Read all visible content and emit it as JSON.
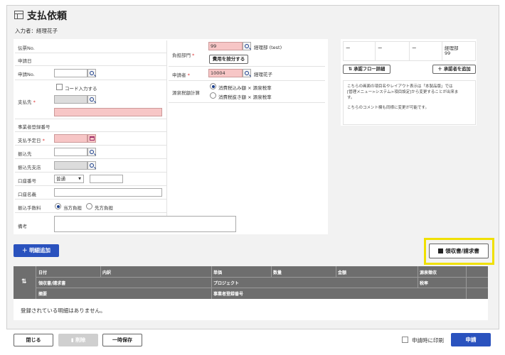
{
  "page": {
    "title": "支払依頼",
    "entrant": "入力者：経理花子"
  },
  "form": {
    "slip_no_label": "伝票No.",
    "apply_date_label": "申請日",
    "apply_no_label": "申請No.",
    "code_input_label": "コード入力する",
    "payee_label": "支払先",
    "required_mark": "*",
    "biz_reg_no_label": "事業者登録番号",
    "pay_due_label": "支払予定日",
    "bank_label": "振込先",
    "bank_branch_label": "振込先支店",
    "account_no_label": "口座番号",
    "account_type_value": "普通",
    "account_name_label": "口座名義",
    "fee_label": "振込手数料",
    "fee_options": [
      "当方負担",
      "先方負担"
    ],
    "notes_label": "備考",
    "dept_label": "負担部門",
    "dept_code": "99",
    "dept_name": "経理部 (test)",
    "split_cost_button": "費用を按分する",
    "applicant_label": "申請者",
    "applicant_code": "10004",
    "applicant_name": "経理花子",
    "wht_label": "源泉税額計算",
    "wht_options": [
      "消費税込み額 × 源泉税率",
      "消費税抜き額 × 源泉税率"
    ]
  },
  "approval": {
    "cells": [
      "ー",
      "ー",
      "ー"
    ],
    "final_cell": [
      "経理部",
      "99"
    ],
    "flow_button": "承認フロー詳細",
    "add_approver_button": "承認者を追加",
    "note_lines": [
      "こちらの画面の項目名やレイアウト表示は「本製品版」では",
      "[管理メニュー>システム>項目設定]から変更することが出来ま",
      "す。",
      "",
      "こちらのコメント欄も同様に変更が可能です。"
    ]
  },
  "details": {
    "add_button": "明細追加",
    "receipt_button": "領収書/請求書",
    "headers_row1": [
      "日付",
      "内訳",
      "単価",
      "数量",
      "金額",
      "源泉徴収"
    ],
    "headers_row2": [
      "領収書/請求書",
      "プロジェクト",
      "税率"
    ],
    "headers_row3": [
      "摘要",
      "事業者登録番号"
    ],
    "empty_message": "登録されている明細はありません。"
  },
  "footer": {
    "close_button": "閉じる",
    "delete_button": "削除",
    "temp_save_button": "一時保存",
    "print_label": "申請時に印刷",
    "submit_button": "申請"
  },
  "colors": {
    "accent": "#2a52be",
    "required_input": "#f7c6c6",
    "highlight": "#f0e000",
    "table_header": "#6e6e6e"
  }
}
